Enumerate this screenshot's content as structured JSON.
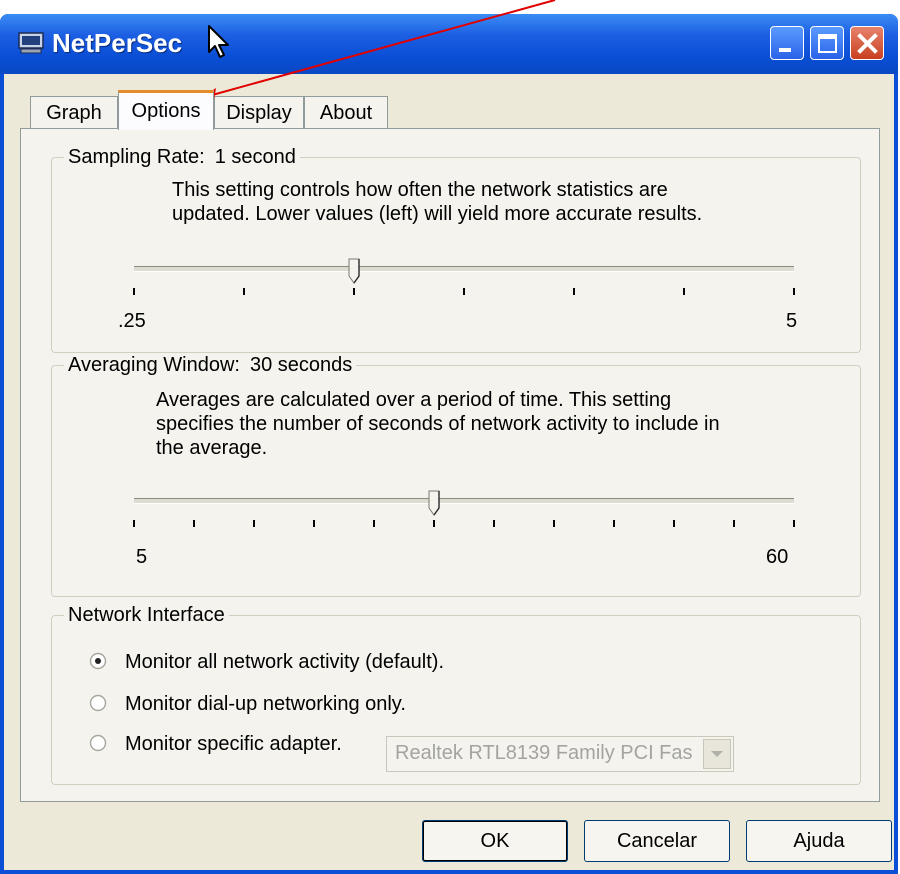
{
  "window": {
    "title": "NetPerSec",
    "colors": {
      "titlebar": "#0a4fd6",
      "client": "#ece9d8",
      "close": "#c8401f"
    }
  },
  "tabs": [
    {
      "label": "Graph"
    },
    {
      "label": "Options"
    },
    {
      "label": "Display"
    },
    {
      "label": "About"
    }
  ],
  "active_tab": "Options",
  "sampling": {
    "title": "Sampling Rate:",
    "value": "1 second",
    "description_line1": "This setting controls how often the network statistics are",
    "description_line2": "updated.  Lower values (left) will yield more accurate results.",
    "min_label": ".25",
    "max_label": "5",
    "tick_count": 7,
    "position_fraction": 0.333
  },
  "averaging": {
    "title": "Averaging Window:",
    "value": "30 seconds",
    "description_line1": "Averages are calculated over a period of time.   This setting",
    "description_line2": "specifies the number of seconds of network activity to include in",
    "description_line3": "the average.",
    "min_label": "5",
    "max_label": "60",
    "tick_count": 12,
    "position_fraction": 0.454
  },
  "network": {
    "title": "Network Interface",
    "options": [
      {
        "label": "Monitor all network activity (default).",
        "selected": true
      },
      {
        "label": "Monitor dial-up networking only.",
        "selected": false
      },
      {
        "label": "Monitor specific adapter.",
        "selected": false
      }
    ],
    "adapter_value": "Realtek RTL8139 Family PCI Fas"
  },
  "buttons": {
    "ok": "OK",
    "cancel": "Cancelar",
    "help": "Ajuda"
  },
  "annotation": {
    "color": "#e00000"
  }
}
